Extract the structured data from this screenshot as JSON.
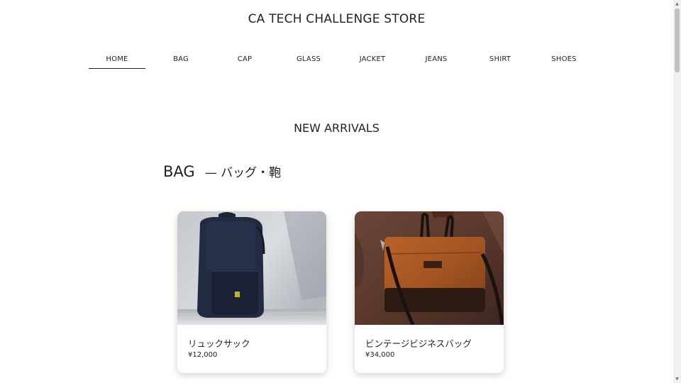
{
  "header": {
    "title": "CA TECH CHALLENGE STORE"
  },
  "nav": {
    "items": [
      {
        "label": "HOME",
        "active": true
      },
      {
        "label": "BAG"
      },
      {
        "label": "CAP"
      },
      {
        "label": "GLASS"
      },
      {
        "label": "JACKET"
      },
      {
        "label": "JEANS"
      },
      {
        "label": "SHIRT"
      },
      {
        "label": "SHOES"
      }
    ]
  },
  "section": {
    "title": "NEW ARRIVALS"
  },
  "category": {
    "name_en": "BAG",
    "name_jp": "— バッグ・鞄"
  },
  "products": [
    {
      "name": "リュックサック",
      "price": "¥12,000",
      "image": "backpack-photo"
    },
    {
      "name": "ビンテージビジネスバッグ",
      "price": "¥34,000",
      "image": "leather-business-bag-photo"
    }
  ],
  "colors": {
    "text": "#222222",
    "background": "#ffffff"
  }
}
